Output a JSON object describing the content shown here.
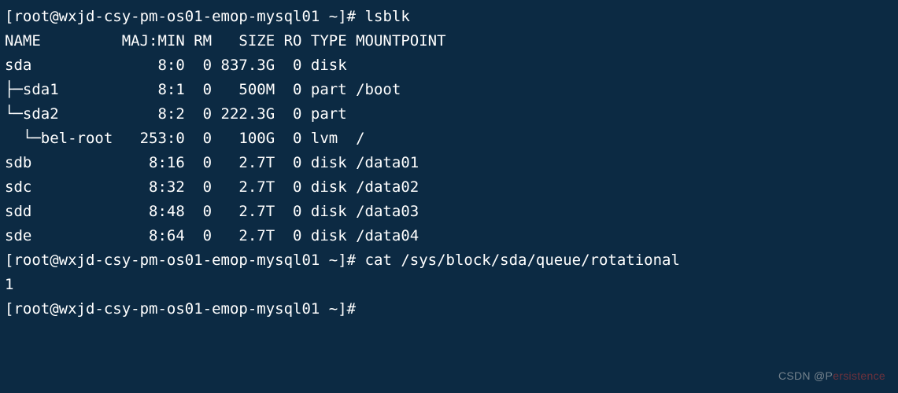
{
  "prompt_prefix": "[root@wxjd-csy-pm-os01-emop-mysql01 ~]# ",
  "commands": {
    "lsblk": "lsblk",
    "cat_rot": "cat /sys/block/sda/queue/rotational"
  },
  "lsblk_header": {
    "name": "NAME",
    "majmin": "MAJ:MIN",
    "rm": "RM",
    "size": "SIZE",
    "ro": "RO",
    "type": "TYPE",
    "mount": "MOUNTPOINT"
  },
  "lsblk_rows": [
    {
      "name": "sda",
      "majmin": "8:0",
      "rm": "0",
      "size": "837.3G",
      "ro": "0",
      "type": "disk",
      "mount": ""
    },
    {
      "name": "├─sda1",
      "majmin": "8:1",
      "rm": "0",
      "size": "500M",
      "ro": "0",
      "type": "part",
      "mount": "/boot"
    },
    {
      "name": "└─sda2",
      "majmin": "8:2",
      "rm": "0",
      "size": "222.3G",
      "ro": "0",
      "type": "part",
      "mount": ""
    },
    {
      "name": "  └─bel-root",
      "majmin": "253:0",
      "rm": "0",
      "size": "100G",
      "ro": "0",
      "type": "lvm",
      "mount": "/"
    },
    {
      "name": "sdb",
      "majmin": "8:16",
      "rm": "0",
      "size": "2.7T",
      "ro": "0",
      "type": "disk",
      "mount": "/data01"
    },
    {
      "name": "sdc",
      "majmin": "8:32",
      "rm": "0",
      "size": "2.7T",
      "ro": "0",
      "type": "disk",
      "mount": "/data02"
    },
    {
      "name": "sdd",
      "majmin": "8:48",
      "rm": "0",
      "size": "2.7T",
      "ro": "0",
      "type": "disk",
      "mount": "/data03"
    },
    {
      "name": "sde",
      "majmin": "8:64",
      "rm": "0",
      "size": "2.7T",
      "ro": "0",
      "type": "disk",
      "mount": "/data04"
    }
  ],
  "cat_output": "1",
  "watermark": {
    "left": "CSDN @P",
    "mid": "ersistence",
    "right": ""
  }
}
